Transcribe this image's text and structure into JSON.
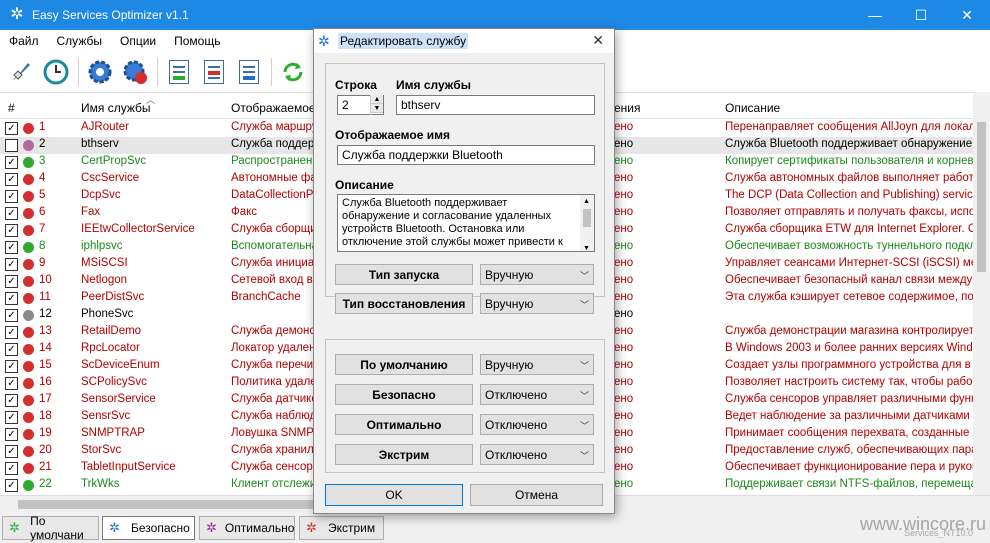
{
  "window": {
    "title": "Easy Services Optimizer v1.1"
  },
  "menu": [
    "Файл",
    "Службы",
    "Опции",
    "Помощь"
  ],
  "toolbar_icons": [
    "rocket-icon",
    "clock-icon",
    "gear-blue-icon",
    "gear-red-icon",
    "doc-add-icon",
    "doc-remove-icon",
    "doc-edit-icon",
    "refresh-icon"
  ],
  "grid": {
    "headers": {
      "num": "#",
      "name": "Имя службы",
      "display": "Отображаемое и",
      "status": "ения",
      "desc": "Описание"
    },
    "rows": [
      {
        "checked": true,
        "dot": "#d32f2f",
        "num": "1",
        "name": "AJRouter",
        "disp": "Служба маршрут",
        "stat": "ено",
        "desc": "Перенаправляет сообщения AllJoyn для локальн",
        "color": "red"
      },
      {
        "checked": false,
        "dot": "#b06aa0",
        "num": "2",
        "name": "bthserv",
        "disp": "Служба поддерж",
        "stat": "ено",
        "desc": "Служба Bluetooth поддерживает обнаружение и с",
        "color": "blk",
        "sel": true
      },
      {
        "checked": true,
        "dot": "#2eaa2e",
        "num": "3",
        "name": "CertPropSvc",
        "disp": "Распространени",
        "stat": "ено",
        "desc": "Копирует сертификаты пользователя и корневы",
        "color": "green"
      },
      {
        "checked": true,
        "dot": "#d32f2f",
        "num": "4",
        "name": "CscService",
        "disp": "Автономные фай",
        "stat": "ено",
        "desc": "Служба автономных файлов выполняет работу",
        "color": "red"
      },
      {
        "checked": true,
        "dot": "#d32f2f",
        "num": "5",
        "name": "DcpSvc",
        "disp": "DataCollectionPu",
        "stat": "ено",
        "desc": "The DCP (Data Collection and Publishing) service su",
        "color": "red"
      },
      {
        "checked": true,
        "dot": "#d32f2f",
        "num": "6",
        "name": "Fax",
        "disp": "Факс",
        "stat": "ено",
        "desc": "Позволяет отправлять и получать факсы, испол",
        "color": "red"
      },
      {
        "checked": true,
        "dot": "#d32f2f",
        "num": "7",
        "name": "IEEtwCollectorService",
        "disp": "Служба сборщик",
        "stat": "ено",
        "desc": "Служба сборщика ETW для Internet Explorer. Co",
        "color": "red"
      },
      {
        "checked": true,
        "dot": "#2eaa2e",
        "num": "8",
        "name": "iphlpsvc",
        "disp": "Вспомогательна",
        "stat": "ено",
        "desc": "Обеспечивает возможность туннельного подкл",
        "color": "green"
      },
      {
        "checked": true,
        "dot": "#d32f2f",
        "num": "9",
        "name": "MSiSCSI",
        "disp": "Служба инициат",
        "stat": "ено",
        "desc": "Управляет сеансами Интернет-SCSI (iSCSI) межд",
        "color": "red"
      },
      {
        "checked": true,
        "dot": "#d32f2f",
        "num": "10",
        "name": "Netlogon",
        "disp": "Сетевой вход в",
        "stat": "ено",
        "desc": "Обеспечивает безопасный канал связи между э",
        "color": "red"
      },
      {
        "checked": true,
        "dot": "#d32f2f",
        "num": "11",
        "name": "PeerDistSvc",
        "disp": "BranchCache",
        "stat": "ено",
        "desc": "Эта служба кэширует сетевое содержимое, полу",
        "color": "red"
      },
      {
        "checked": true,
        "dot": "#8a8a8a",
        "num": "12",
        "name": "PhoneSvc",
        "disp": "",
        "stat": "ено",
        "desc": "",
        "color": "blk"
      },
      {
        "checked": true,
        "dot": "#d32f2f",
        "num": "13",
        "name": "RetailDemo",
        "disp": "Служба демонст",
        "stat": "ено",
        "desc": "Служба демонстрации магазина контролирует д",
        "color": "red"
      },
      {
        "checked": true,
        "dot": "#d32f2f",
        "num": "14",
        "name": "RpcLocator",
        "disp": "Локатор удален",
        "stat": "ено",
        "desc": "В Windows 2003 и более ранних версиях Windows",
        "color": "red"
      },
      {
        "checked": true,
        "dot": "#d32f2f",
        "num": "15",
        "name": "ScDeviceEnum",
        "disp": "Служба перечис",
        "stat": "ено",
        "desc": "Создает узлы программного устройства для в",
        "color": "red"
      },
      {
        "checked": true,
        "dot": "#d32f2f",
        "num": "16",
        "name": "SCPolicySvc",
        "disp": "Политика удале",
        "stat": "ено",
        "desc": "Позволяет настроить систему так, чтобы рабоч",
        "color": "red"
      },
      {
        "checked": true,
        "dot": "#d32f2f",
        "num": "17",
        "name": "SensorService",
        "disp": "Служба датчико",
        "stat": "ено",
        "desc": "Служба сенсоров управляет различными функц",
        "color": "red"
      },
      {
        "checked": true,
        "dot": "#d32f2f",
        "num": "18",
        "name": "SensrSvc",
        "disp": "Служба наблюд",
        "stat": "ено",
        "desc": "Ведет наблюдение за различными датчиками д",
        "color": "red"
      },
      {
        "checked": true,
        "dot": "#d32f2f",
        "num": "19",
        "name": "SNMPTRAP",
        "disp": "Ловушка SNMP",
        "stat": "ено",
        "desc": "Принимает сообщения перехвата, созданные ло",
        "color": "red"
      },
      {
        "checked": true,
        "dot": "#d32f2f",
        "num": "20",
        "name": "StorSvc",
        "disp": "Служба хранили",
        "stat": "ено",
        "desc": "Предоставление служб, обеспечивающих парам",
        "color": "red"
      },
      {
        "checked": true,
        "dot": "#d32f2f",
        "num": "21",
        "name": "TabletInputService",
        "disp": "Служба сенсорн",
        "stat": "ено",
        "desc": "Обеспечивает функционирование пера и рукопи",
        "color": "red"
      },
      {
        "checked": true,
        "dot": "#2eaa2e",
        "num": "22",
        "name": "TrkWks",
        "disp": "Клиент отслежи",
        "stat": "ено",
        "desc": "Поддерживает связи NTFS-файлов, перемещаем",
        "color": "green"
      }
    ]
  },
  "tabs": [
    {
      "label": "По умолчани",
      "gear": "#2eaa2e"
    },
    {
      "label": "Безопасно",
      "gear": "#1e6fc9",
      "active": true
    },
    {
      "label": "Оптимально",
      "gear": "#9c2a9c"
    },
    {
      "label": "Экстрим",
      "gear": "#d32f2f"
    }
  ],
  "watermark": {
    "site": "www.wincore.ru",
    "info": "Services_NT10.0"
  },
  "dialog": {
    "title": "Редактировать службу",
    "row_label": "Строка",
    "row_value": "2",
    "name_label": "Имя службы",
    "name_value": "bthserv",
    "display_label": "Отображаемое имя",
    "display_value": "Служба поддержки Bluetooth",
    "desc_label": "Описание",
    "desc_value": "Служба Bluetooth поддерживает обнаружение и согласование удаленных устройств Bluetooth. Остановка или отключение этой службы может привести к",
    "startup_label": "Тип запуска",
    "startup_value": "Вручную",
    "recovery_label": "Тип восстановления",
    "recovery_value": "Вручную",
    "presets": [
      {
        "label": "По умолчанию",
        "value": "Вручную"
      },
      {
        "label": "Безопасно",
        "value": "Отключено"
      },
      {
        "label": "Оптимально",
        "value": "Отключено"
      },
      {
        "label": "Экстрим",
        "value": "Отключено"
      }
    ],
    "ok_label": "OK",
    "cancel_label": "Отмена"
  },
  "colors": {
    "red": "#b40000",
    "green": "#1a8a1a",
    "accent": "#1e88e5"
  }
}
